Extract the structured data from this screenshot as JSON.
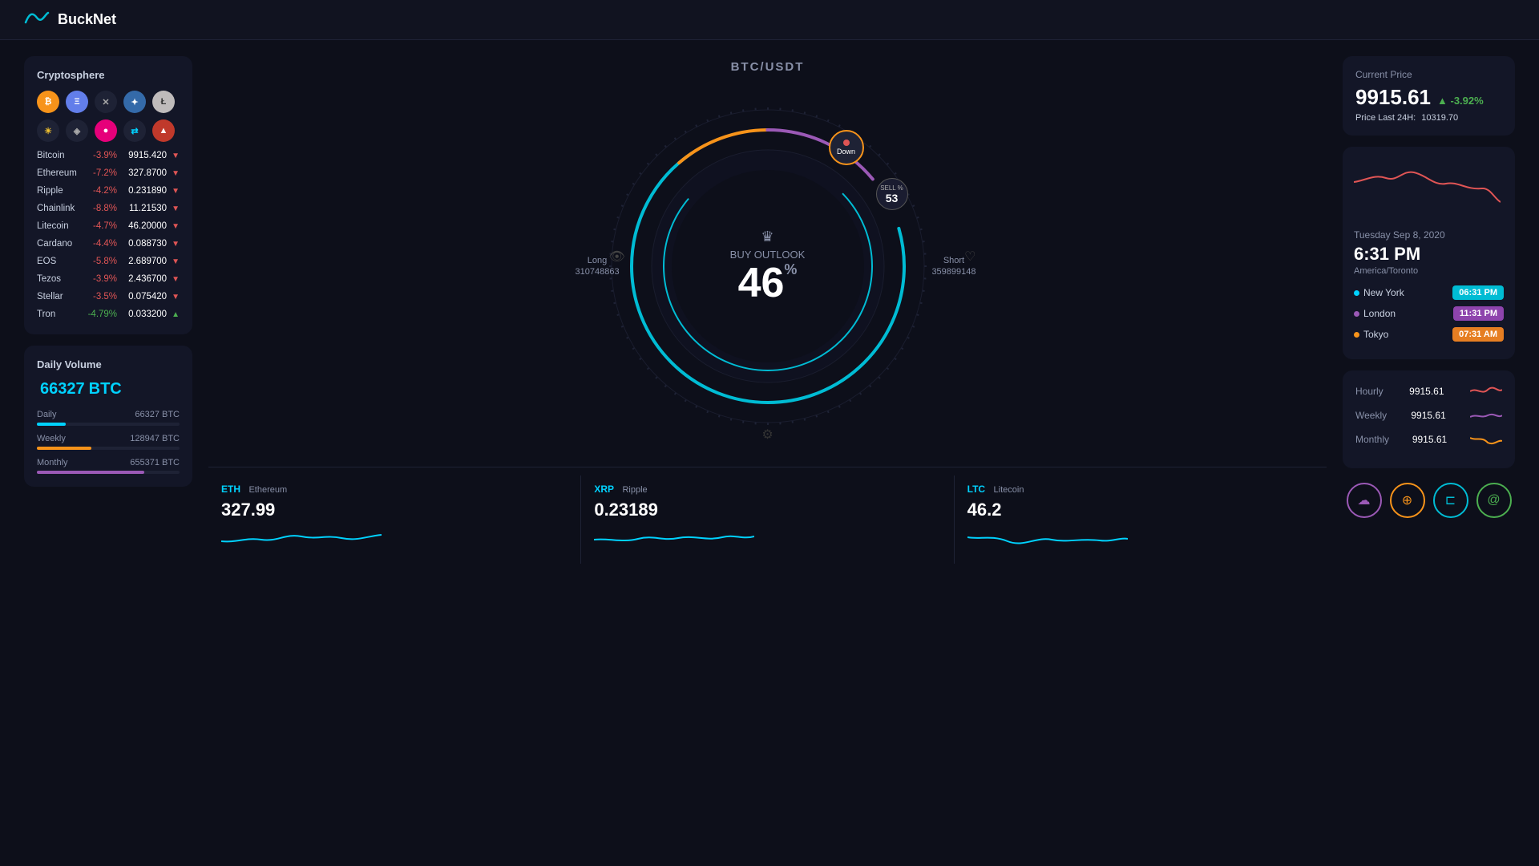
{
  "app": {
    "name": "BuckNet"
  },
  "navbar": {
    "logo_text": "BuckNet"
  },
  "cryptosphere": {
    "title": "Cryptosphere",
    "icons": [
      {
        "symbol": "₿",
        "class": "ci-btc",
        "name": "bitcoin"
      },
      {
        "symbol": "Ξ",
        "class": "ci-eth",
        "name": "ethereum"
      },
      {
        "symbol": "✕",
        "class": "ci-x",
        "name": "close"
      },
      {
        "symbol": "✦",
        "class": "ci-xrp",
        "name": "xrp"
      },
      {
        "symbol": "Ł",
        "class": "ci-ltc",
        "name": "litecoin"
      },
      {
        "symbol": "☀",
        "class": "ci-sun",
        "name": "sun"
      },
      {
        "symbol": "◈",
        "class": "ci-ghost",
        "name": "ghost"
      },
      {
        "symbol": "●",
        "class": "ci-dot",
        "name": "dot"
      },
      {
        "symbol": "⇄",
        "class": "ci-swap",
        "name": "swap"
      },
      {
        "symbol": "▲",
        "class": "ci-red",
        "name": "red"
      }
    ],
    "coins": [
      {
        "name": "Bitcoin",
        "pct": "-3.9%",
        "price": "9915.420",
        "up": false
      },
      {
        "name": "Ethereum",
        "pct": "-7.2%",
        "price": "327.8700",
        "up": false
      },
      {
        "name": "Ripple",
        "pct": "-4.2%",
        "price": "0.231890",
        "up": false
      },
      {
        "name": "Chainlink",
        "pct": "-8.8%",
        "price": "11.21530",
        "up": false
      },
      {
        "name": "Litecoin",
        "pct": "-4.7%",
        "price": "46.20000",
        "up": false
      },
      {
        "name": "Cardano",
        "pct": "-4.4%",
        "price": "0.088730",
        "up": false
      },
      {
        "name": "EOS",
        "pct": "-5.8%",
        "price": "2.689700",
        "up": false
      },
      {
        "name": "Tezos",
        "pct": "-3.9%",
        "price": "2.436700",
        "up": false
      },
      {
        "name": "Stellar",
        "pct": "-3.5%",
        "price": "0.075420",
        "up": false
      },
      {
        "name": "Tron",
        "pct": "-4.79%",
        "price": "0.033200",
        "up": true
      }
    ]
  },
  "daily_volume": {
    "title": "Daily Volume",
    "amount": "66327",
    "unit": "BTC",
    "rows": [
      {
        "label": "Daily",
        "value": "66327 BTC",
        "bar_width": "20%",
        "bar_class": "bar-blue"
      },
      {
        "label": "Weekly",
        "value": "128947 BTC",
        "bar_width": "38%",
        "bar_class": "bar-orange"
      },
      {
        "label": "Monthly",
        "value": "655371 BTC",
        "bar_width": "75%",
        "bar_class": "bar-purple"
      }
    ]
  },
  "gauge": {
    "pair": "BTC/USDT",
    "label": "BUY OUTLOOK",
    "value": "46",
    "pct_symbol": "%",
    "long_label": "Long",
    "long_value": "310748863",
    "short_label": "Short",
    "short_value": "359899148",
    "down_label": "Down",
    "sell_label": "SELL %",
    "sell_value": "53"
  },
  "tickers": [
    {
      "symbol": "ETH",
      "name": "Ethereum",
      "price": "327.99"
    },
    {
      "symbol": "XRP",
      "name": "Ripple",
      "price": "0.23189"
    },
    {
      "symbol": "LTC",
      "name": "Litecoin",
      "price": "46.2"
    }
  ],
  "current_price": {
    "title": "Current Price",
    "value": "9915.61",
    "change": "-3.92%",
    "last24_label": "Price Last 24H:",
    "last24_value": "10319.70"
  },
  "time_card": {
    "date": "Tuesday Sep 8, 2020",
    "time": "6:31 PM",
    "timezone": "America/Toronto",
    "cities": [
      {
        "name": "New York",
        "dot_class": "city-dot-ny",
        "time": "06:31 PM",
        "badge_class": "badge-blue"
      },
      {
        "name": "London",
        "dot_class": "city-dot-lon",
        "time": "11:31 PM",
        "badge_class": "badge-purple"
      },
      {
        "name": "Tokyo",
        "dot_class": "city-dot-tok",
        "time": "07:31 AM",
        "badge_class": "badge-orange"
      }
    ]
  },
  "hwm": [
    {
      "label": "Hourly",
      "value": "9915.61",
      "color": "#e05555"
    },
    {
      "label": "Weekly",
      "value": "9915.61",
      "color": "#9b59b6"
    },
    {
      "label": "Monthly",
      "value": "9915.61",
      "color": "#f7931a"
    }
  ],
  "bottom_icons": [
    {
      "class": "icb-purple",
      "symbol": "☁",
      "name": "cloud"
    },
    {
      "class": "icb-orange",
      "symbol": "⊕",
      "name": "network"
    },
    {
      "class": "icb-cyan",
      "symbol": "⊏",
      "name": "layers"
    },
    {
      "class": "icb-green",
      "symbol": "@",
      "name": "at"
    }
  ]
}
